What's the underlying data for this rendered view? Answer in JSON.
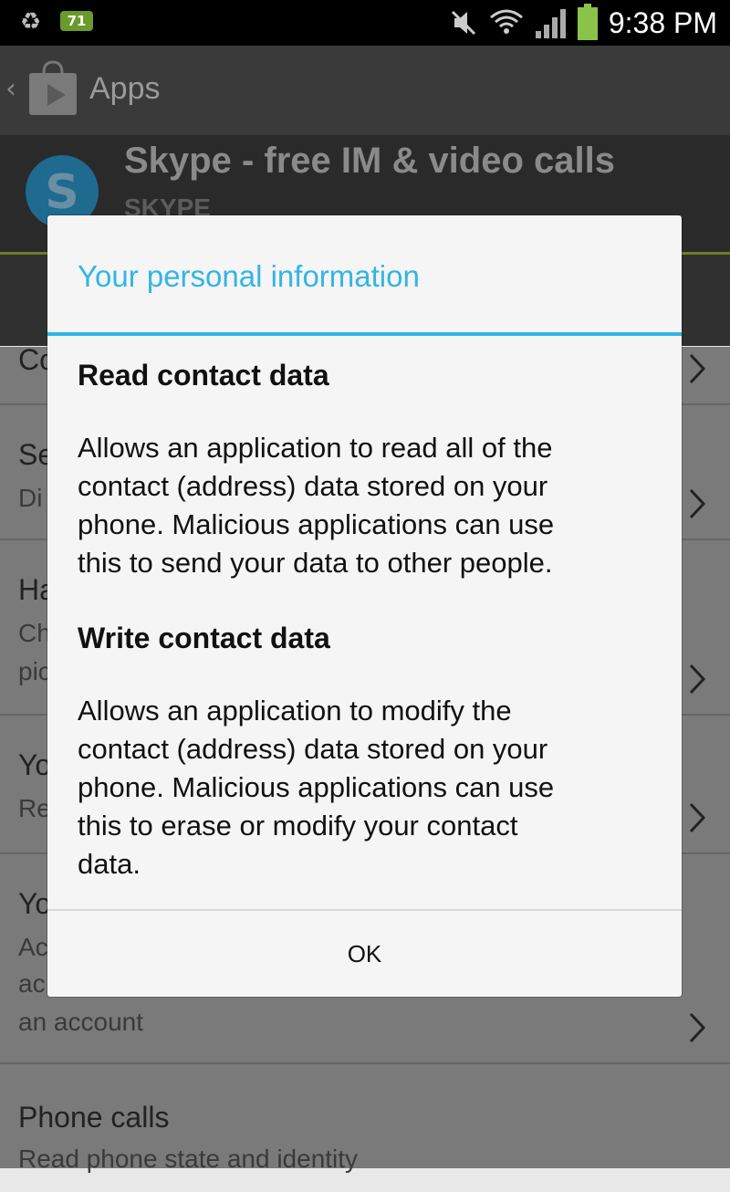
{
  "status_bar": {
    "battery_badge": "71",
    "time": "9:38 PM",
    "icons": [
      "recycle-icon",
      "mute-icon",
      "wifi-icon",
      "signal-icon",
      "battery-icon"
    ]
  },
  "action_bar": {
    "title": "Apps",
    "icons": [
      "back-chevron-icon",
      "play-store-icon"
    ]
  },
  "app_header": {
    "name": "Skype - free IM & video calls",
    "developer": "SKYPE"
  },
  "permissions": [
    {
      "title": "Co",
      "desc": ""
    },
    {
      "title": "Se",
      "desc": "Di"
    },
    {
      "title": "Ha",
      "desc": "Ch",
      "desc2": "pic"
    },
    {
      "title": "Yo",
      "desc": "Re"
    },
    {
      "title": "Yo",
      "desc": "Ac",
      "desc2": "ac",
      "desc3": "an account"
    },
    {
      "title": "Phone calls",
      "desc": "Read phone state and identity"
    }
  ],
  "dialog": {
    "title": "Your personal information",
    "sections": [
      {
        "heading": "Read contact data",
        "lines": [
          "Allows an application to read all of the",
          "contact (address) data stored on your",
          "phone. Malicious applications can use",
          "this to send your data to other people."
        ]
      },
      {
        "heading": "Write contact data",
        "lines": [
          "Allows an application to modify the",
          "contact (address) data stored on your",
          "phone. Malicious applications can use",
          "this to erase or modify your contact",
          "data."
        ]
      }
    ],
    "ok_label": "OK"
  },
  "colors": {
    "accent": "#33b5e5",
    "status_bar": "#000000",
    "dialog_bg": "#f5f5f5"
  }
}
